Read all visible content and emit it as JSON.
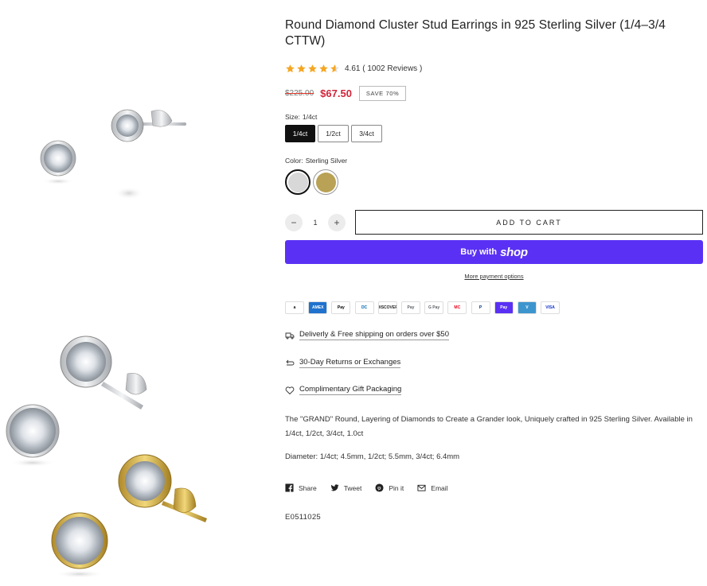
{
  "product": {
    "title": "Round Diamond Cluster Stud Earrings in 925 Sterling Silver (1/4–3/4 CTTW)",
    "rating_value": "4.61",
    "rating_count": "( 1002  Reviews )",
    "stars": 4.61,
    "compare_price": "$225.00",
    "sale_price": "$67.50",
    "save_badge": "SAVE 70%",
    "sku": "E0511025"
  },
  "size": {
    "label": "Size:",
    "selected": "1/4ct",
    "options": [
      "1/4ct",
      "1/2ct",
      "3/4ct"
    ]
  },
  "color": {
    "label": "Color:",
    "selected": "Sterling Silver",
    "swatches": [
      {
        "name": "Sterling Silver",
        "hex": "#d8d8d8"
      },
      {
        "name": "Gold",
        "hex": "#b9a155"
      }
    ]
  },
  "quantity": {
    "minus": "−",
    "value": "1",
    "plus": "+"
  },
  "buttons": {
    "add_to_cart": "ADD TO CART",
    "buy_with": "Buy with",
    "shop": "shop",
    "more_payment": "More payment options"
  },
  "payment_icons": [
    {
      "name": "amazon-pay-icon",
      "text": "a",
      "bg": "#fff",
      "fg": "#111"
    },
    {
      "name": "amex-icon",
      "text": "AMEX",
      "bg": "#1f72cd",
      "fg": "#fff"
    },
    {
      "name": "apple-pay-icon",
      "text": "Pay",
      "bg": "#fff",
      "fg": "#000"
    },
    {
      "name": "diners-club-icon",
      "text": "DC",
      "bg": "#fff",
      "fg": "#0165ac"
    },
    {
      "name": "discover-icon",
      "text": "DISCOVER",
      "bg": "#fff",
      "fg": "#222"
    },
    {
      "name": "google-pay-icon",
      "text": "Pay",
      "bg": "#fff",
      "fg": "#5f6368"
    },
    {
      "name": "gpay-icon",
      "text": "G Pay",
      "bg": "#fff",
      "fg": "#5f6368"
    },
    {
      "name": "mastercard-icon",
      "text": "MC",
      "bg": "#fff",
      "fg": "#eb001b"
    },
    {
      "name": "paypal-icon",
      "text": "P",
      "bg": "#fff",
      "fg": "#003087"
    },
    {
      "name": "shop-pay-icon",
      "text": "Pay",
      "bg": "#5a31f4",
      "fg": "#fff"
    },
    {
      "name": "venmo-icon",
      "text": "V",
      "bg": "#3d95ce",
      "fg": "#fff"
    },
    {
      "name": "visa-icon",
      "text": "VISA",
      "bg": "#fff",
      "fg": "#1434cb"
    }
  ],
  "features": [
    {
      "icon": "truck-icon",
      "text": "Deliverly & Free shipping on orders over $50"
    },
    {
      "icon": "return-arrow-icon",
      "text": "30-Day Returns or Exchanges"
    },
    {
      "icon": "heart-icon",
      "text": "Complimentary Gift Packaging"
    }
  ],
  "description": {
    "paragraph1": "The \"GRAND\" Round, Layering of Diamonds to Create a Grander look, Uniquely crafted in 925 Sterling Silver.  Available in 1/4ct, 1/2ct, 3/4ct, 1.0ct",
    "paragraph2": "Diameter: 1/4ct; 4.5mm, 1/2ct; 5.5mm, 3/4ct; 6.4mm"
  },
  "share": [
    {
      "icon": "facebook-icon",
      "label": "Share"
    },
    {
      "icon": "twitter-icon",
      "label": "Tweet"
    },
    {
      "icon": "pinterest-icon",
      "label": "Pin it"
    },
    {
      "icon": "email-icon",
      "label": "Email"
    }
  ],
  "colors": {
    "sale": "#d0263a",
    "shop_pay": "#5a31f4",
    "star": "#f5a623"
  }
}
